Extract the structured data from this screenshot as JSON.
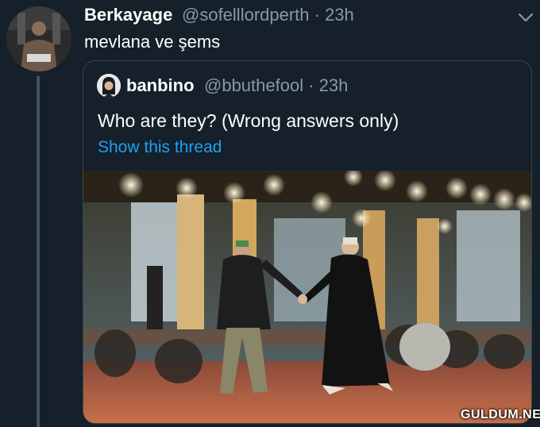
{
  "tweet": {
    "author_name": "Berkayage",
    "handle_time": "@sofelllordperth · 23h",
    "text": "mevlana ve şems"
  },
  "quoted": {
    "author_name": "banbino",
    "handle_time": "@bbuthefool · 23h",
    "text": "Who are they? (Wrong answers only)",
    "link_text": "Show this thread"
  },
  "icons": {
    "menu": "chevron-down-icon"
  },
  "colors": {
    "background": "#15202b",
    "secondary_text": "#8899a6",
    "link": "#1da1f2",
    "border": "#38444d"
  },
  "watermark": "GULDUM.NET"
}
